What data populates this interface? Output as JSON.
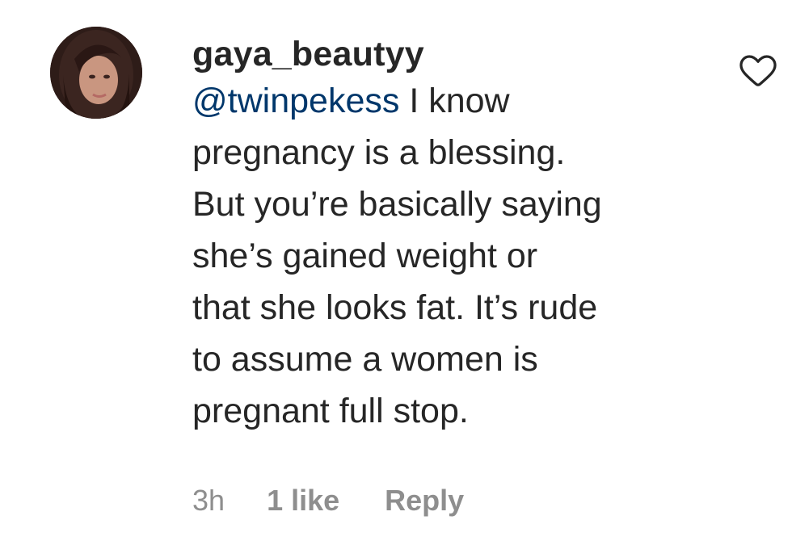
{
  "comment": {
    "username": "gaya_beautyy",
    "mention": "@twinpekess",
    "text_first": " I know",
    "lines": [
      "pregnancy is a blessing.",
      "But you’re basically saying",
      "she’s gained weight or",
      "that she looks fat. It’s rude",
      "to assume a women is",
      "pregnant full stop."
    ],
    "time": "3h",
    "likes": "1 like",
    "reply_label": "Reply"
  },
  "icons": {
    "avatar": "user-avatar",
    "like": "heart-icon"
  },
  "colors": {
    "text": "#262626",
    "mention": "#00376b",
    "meta": "#8e8e8e"
  }
}
